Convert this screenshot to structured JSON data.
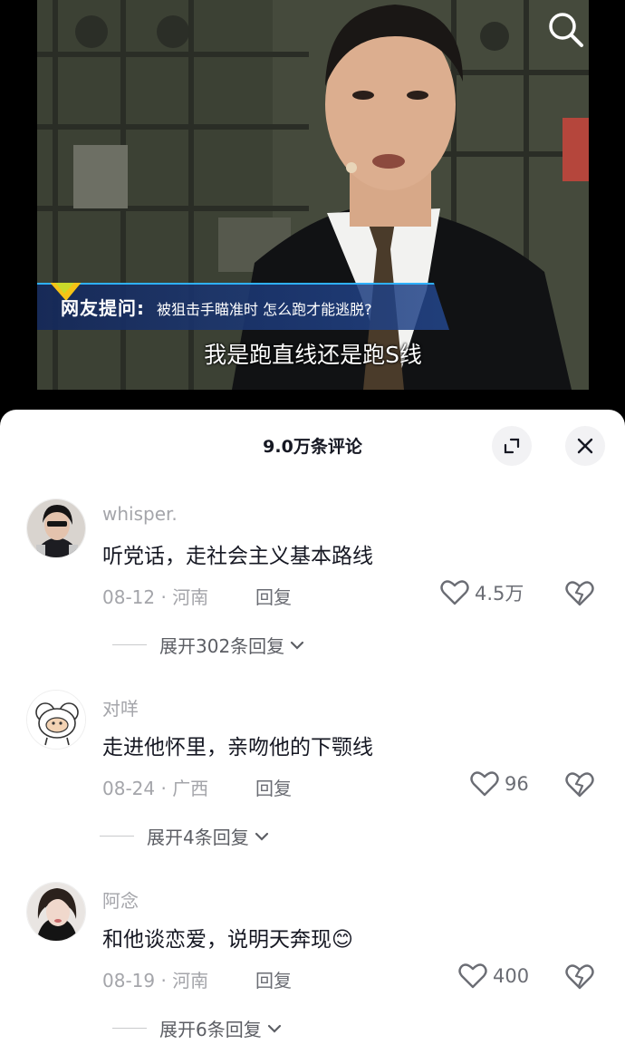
{
  "video": {
    "banner_tag": "网友提问:",
    "banner_question": "被狙击手瞄准时 怎么跑才能逃脱?",
    "subtitle": "我是跑直线还是跑S线"
  },
  "panel": {
    "title": "9.0万条评论"
  },
  "comments": [
    {
      "username": "whisper.",
      "text": "听党话，走社会主义基本路线",
      "meta": "08-12 · 河南",
      "reply_label": "回复",
      "likes": "4.5万",
      "expand_label": "展开302条回复"
    },
    {
      "username": "对咩",
      "text": "走进他怀里，亲吻他的下颚线",
      "meta": "08-24 · 广西",
      "reply_label": "回复",
      "likes": "96",
      "expand_label": "展开4条回复"
    },
    {
      "username": "阿念",
      "text": "和他谈恋爱，说明天奔现😊",
      "meta": "08-19 · 河南",
      "reply_label": "回复",
      "likes": "400",
      "expand_label": "展开6条回复"
    }
  ],
  "icons": {
    "search": "search-icon",
    "expand": "expand-icon",
    "close": "close-icon",
    "like": "heart-icon",
    "dislike": "broken-heart-icon",
    "chevron": "chevron-down-icon"
  }
}
